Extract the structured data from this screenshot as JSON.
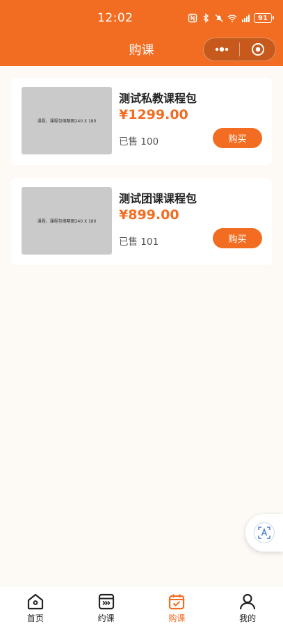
{
  "status_bar": {
    "time": "12:02",
    "battery": "91"
  },
  "header": {
    "title": "购课"
  },
  "courses": [
    {
      "image_text": "课程、课程包缩略图240 X 180",
      "title": "测试私教课程包",
      "price": "¥1299.00",
      "sold": "已售 100",
      "buy_label": "购买"
    },
    {
      "image_text": "课程、课程包缩略图240 X 180",
      "title": "测试团课课程包",
      "price": "¥899.00",
      "sold": "已售 101",
      "buy_label": "购买"
    }
  ],
  "tabbar": {
    "items": [
      {
        "label": "首页",
        "icon": "home-icon"
      },
      {
        "label": "约课",
        "icon": "calendar-icon"
      },
      {
        "label": "购课",
        "icon": "calendar-check-icon"
      },
      {
        "label": "我的",
        "icon": "user-icon"
      }
    ],
    "active": 2
  },
  "colors": {
    "accent": "#f26d22",
    "background": "#fdfaf6"
  }
}
